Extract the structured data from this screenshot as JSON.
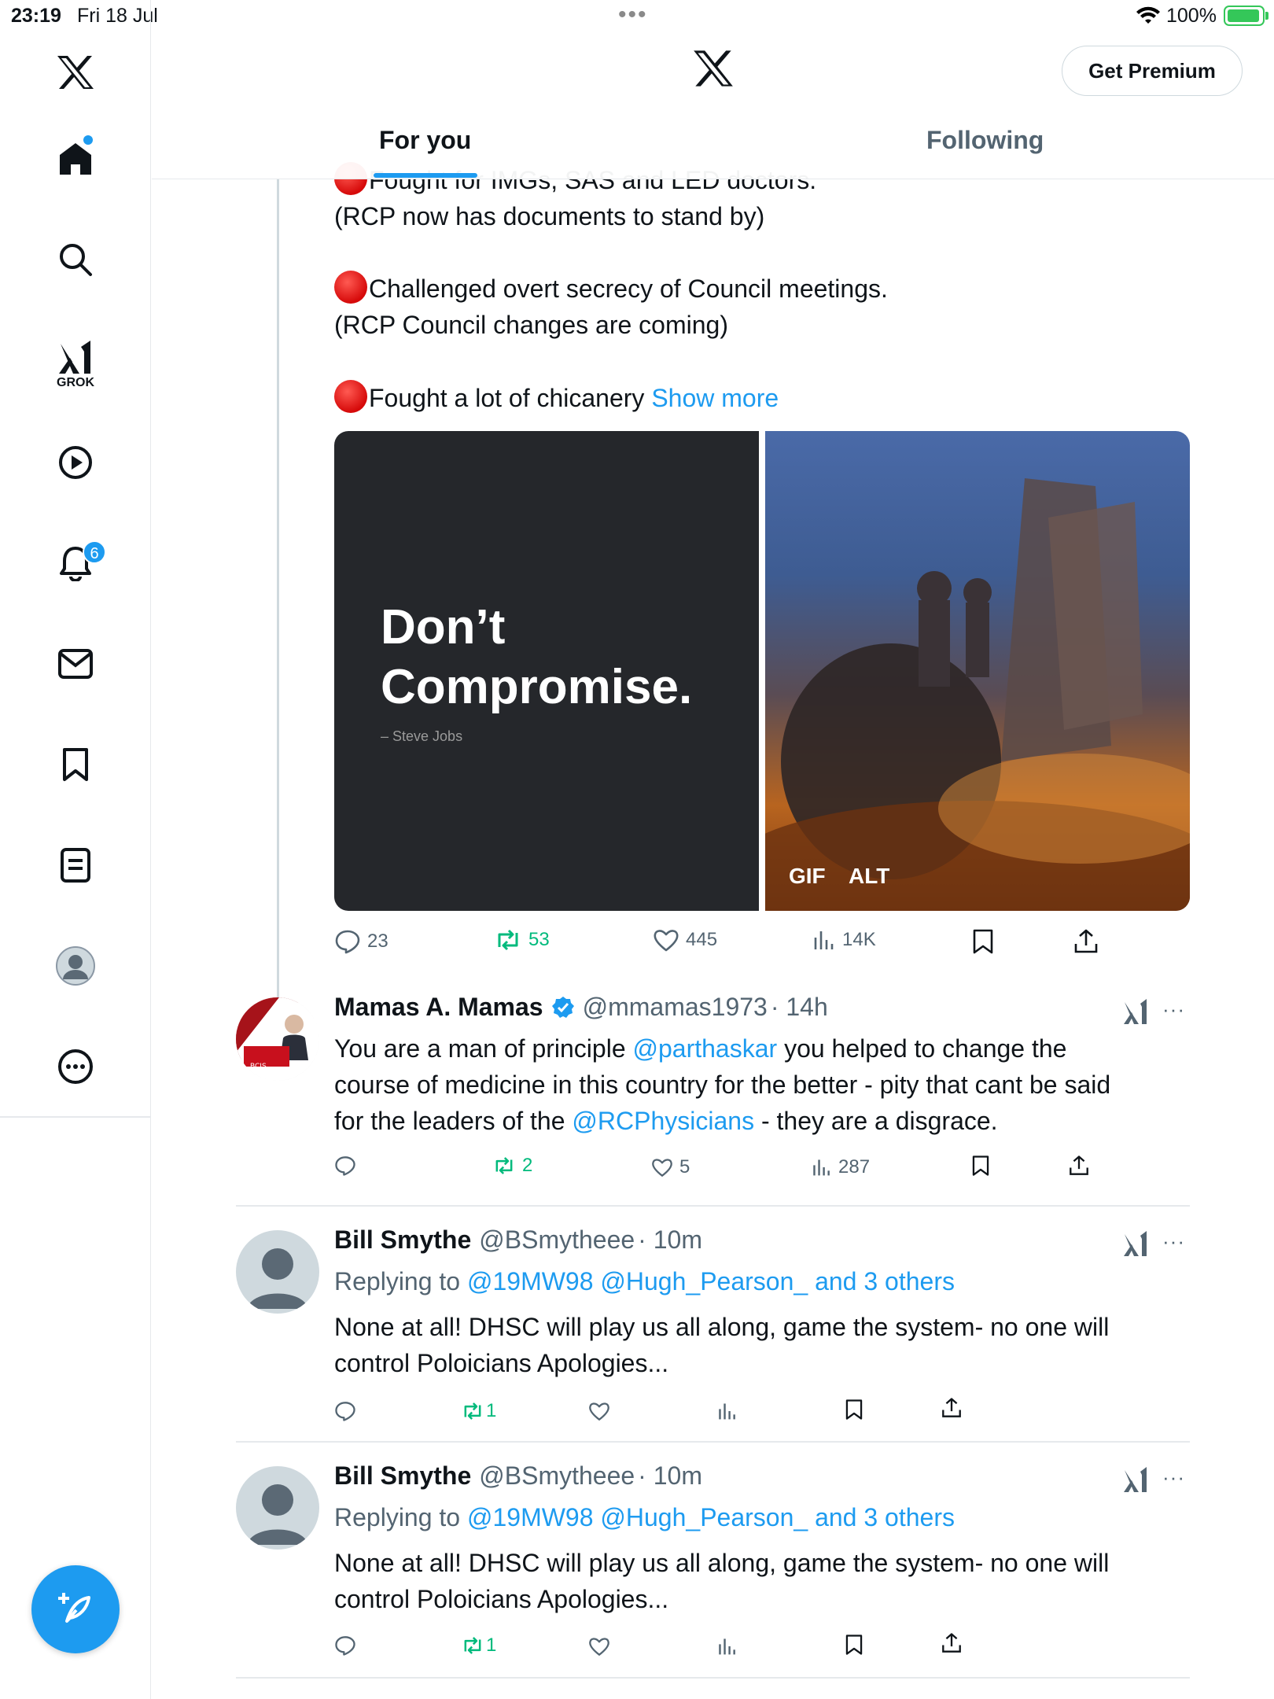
{
  "status_bar": {
    "time": "23:19",
    "date": "Fri 18 Jul",
    "battery": "100%"
  },
  "sidebar": {
    "items": [
      "home",
      "explore",
      "grok",
      "videos",
      "notifications",
      "messages",
      "bookmarks",
      "lists",
      "profile",
      "more"
    ],
    "grok_label": "GROK",
    "notification_count": "6"
  },
  "header": {
    "premium_label": "Get Premium",
    "tabs": [
      {
        "label": "For you",
        "active": true
      },
      {
        "label": "Following",
        "active": false
      }
    ]
  },
  "main_tweet": {
    "lines": [
      "Fought for IMGs, SAS and LED doctors.",
      "(RCP now has documents to stand by)",
      "Challenged overt secrecy of Council meetings.",
      "(RCP Council changes are coming)",
      "Fought a lot of chicanery"
    ],
    "show_more": "Show more",
    "media_left": {
      "title_line1": "Don’t",
      "title_line2": "Compromise.",
      "caption": "– Steve Jobs"
    },
    "media_right": {
      "badge_gif": "GIF",
      "badge_alt": "ALT"
    },
    "actions": {
      "replies": "23",
      "reposts": "53",
      "likes": "445",
      "views": "14K"
    }
  },
  "replies": [
    {
      "name": "Mamas A. Mamas",
      "verified": true,
      "handle": "@mmamas1973",
      "time": "· 14h",
      "text_parts": [
        "You are a man of principle ",
        "@parthaskar",
        " you helped to change the",
        "course of medicine in this country for the better - pity that cant be said",
        "for the leaders of the ",
        "@RCPhysicians",
        " - they are a disgrace."
      ],
      "actions": {
        "replies": "",
        "reposts": "2",
        "likes": "5",
        "views": "287"
      }
    },
    {
      "name": "Bill Smythe",
      "handle": "@BSmytheee",
      "time": "· 10m",
      "replying_to": "Replying to",
      "replying_handles": "@19MW98 @Hugh_Pearson_ and 3 others",
      "text_lines": [
        "None at all! DHSC will play us all along, game the system- no one will",
        "control Poloicians Apologies..."
      ],
      "actions": {
        "replies": "",
        "reposts": "1",
        "likes": "",
        "views": ""
      }
    },
    {
      "name": "Bill Smythe",
      "handle": "@BSmytheee",
      "time": "· 10m",
      "replying_to": "Replying to",
      "replying_handles": "@19MW98 @Hugh_Pearson_ and 3 others",
      "text_lines": [
        "None at all! DHSC will play us all along, game the system- no one will",
        "control Poloicians Apologies..."
      ],
      "actions": {
        "replies": "",
        "reposts": "1",
        "likes": "",
        "views": ""
      }
    }
  ],
  "colors": {
    "accent": "#1d9bf0",
    "repost_green": "#00ba7c",
    "muted": "#536471"
  }
}
